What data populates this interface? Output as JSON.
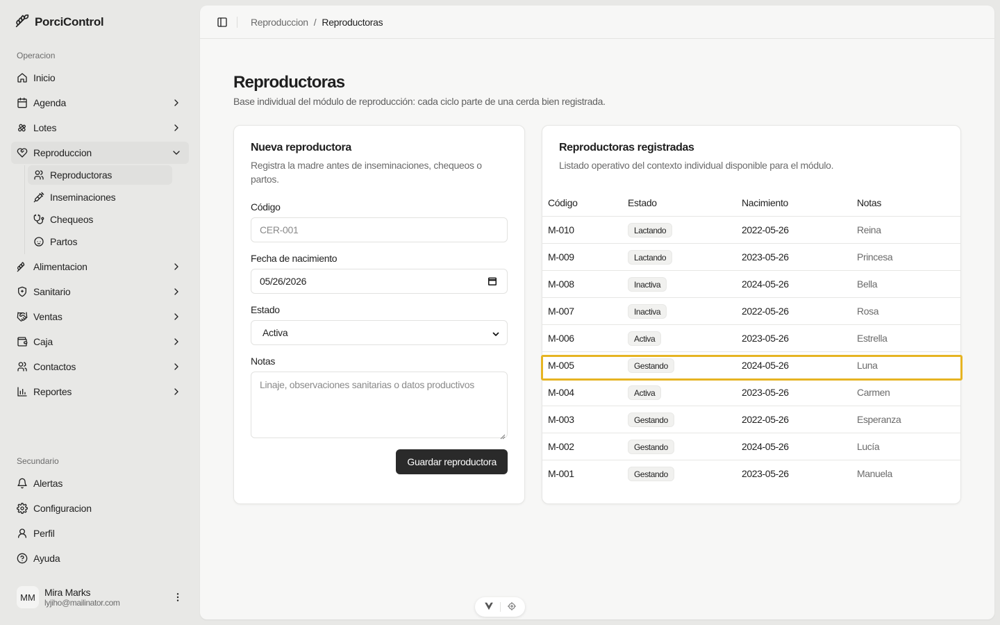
{
  "app": {
    "name": "PorciControl"
  },
  "sidebar": {
    "section_main": "Operacion",
    "items": [
      {
        "label": "Inicio",
        "icon": "home-icon"
      },
      {
        "label": "Agenda",
        "icon": "calendar-icon"
      },
      {
        "label": "Lotes",
        "icon": "group-icon"
      },
      {
        "label": "Reproduccion",
        "icon": "heart-icon"
      },
      {
        "label": "Alimentacion",
        "icon": "wheat-icon"
      },
      {
        "label": "Sanitario",
        "icon": "shield-icon"
      },
      {
        "label": "Ventas",
        "icon": "handshake-icon"
      },
      {
        "label": "Caja",
        "icon": "wallet-icon"
      },
      {
        "label": "Contactos",
        "icon": "users-icon"
      },
      {
        "label": "Reportes",
        "icon": "bar-chart-icon"
      }
    ],
    "sub_items": [
      {
        "label": "Reproductoras",
        "icon": "user-icon"
      },
      {
        "label": "Inseminaciones",
        "icon": "syringe-icon"
      },
      {
        "label": "Chequeos",
        "icon": "stethoscope-icon"
      },
      {
        "label": "Partos",
        "icon": "baby-icon"
      }
    ],
    "section_secondary": "Secundario",
    "secondary_items": [
      {
        "label": "Alertas",
        "icon": "bell-icon"
      },
      {
        "label": "Configuracion",
        "icon": "gear-icon"
      },
      {
        "label": "Perfil",
        "icon": "user-icon"
      },
      {
        "label": "Ayuda",
        "icon": "help-circle-icon"
      }
    ],
    "user": {
      "initials": "MM",
      "name": "Mira Marks",
      "email": "lyjiho@mailinator.com"
    }
  },
  "breadcrumb": {
    "parent": "Reproduccion",
    "separator": "/",
    "current": "Reproductoras"
  },
  "page": {
    "title": "Reproductoras",
    "subtitle": "Base individual del módulo de reproducción: cada ciclo parte de una cerda bien registrada."
  },
  "form": {
    "title": "Nueva reproductora",
    "description": "Registra la madre antes de inseminaciones, chequeos o partos.",
    "code_label": "Código",
    "code_placeholder": "CER-001",
    "birth_label": "Fecha de nacimiento",
    "birth_value": "05/26/2026",
    "state_label": "Estado",
    "state_value": "Activa",
    "notes_label": "Notas",
    "notes_placeholder": "Linaje, observaciones sanitarias o datos productivos",
    "submit_label": "Guardar reproductora"
  },
  "table": {
    "title": "Reproductoras registradas",
    "description": "Listado operativo del contexto individual disponible para el módulo.",
    "columns": [
      "Código",
      "Estado",
      "Nacimiento",
      "Notas"
    ],
    "rows": [
      {
        "code": "M-010",
        "state": "Lactando",
        "birth": "2022-05-26",
        "notes": "Reina"
      },
      {
        "code": "M-009",
        "state": "Lactando",
        "birth": "2023-05-26",
        "notes": "Princesa"
      },
      {
        "code": "M-008",
        "state": "Inactiva",
        "birth": "2024-05-26",
        "notes": "Bella"
      },
      {
        "code": "M-007",
        "state": "Inactiva",
        "birth": "2022-05-26",
        "notes": "Rosa"
      },
      {
        "code": "M-006",
        "state": "Activa",
        "birth": "2023-05-26",
        "notes": "Estrella"
      },
      {
        "code": "M-005",
        "state": "Gestando",
        "birth": "2024-05-26",
        "notes": "Luna"
      },
      {
        "code": "M-004",
        "state": "Activa",
        "birth": "2023-05-26",
        "notes": "Carmen"
      },
      {
        "code": "M-003",
        "state": "Gestando",
        "birth": "2022-05-26",
        "notes": "Esperanza"
      },
      {
        "code": "M-002",
        "state": "Gestando",
        "birth": "2024-05-26",
        "notes": "Lucía"
      },
      {
        "code": "M-001",
        "state": "Gestando",
        "birth": "2023-05-26",
        "notes": "Manuela"
      }
    ]
  },
  "colors": {
    "highlight": "#e6b422",
    "button": "#2a2a2a",
    "accent_bg": "#e0e0de"
  }
}
